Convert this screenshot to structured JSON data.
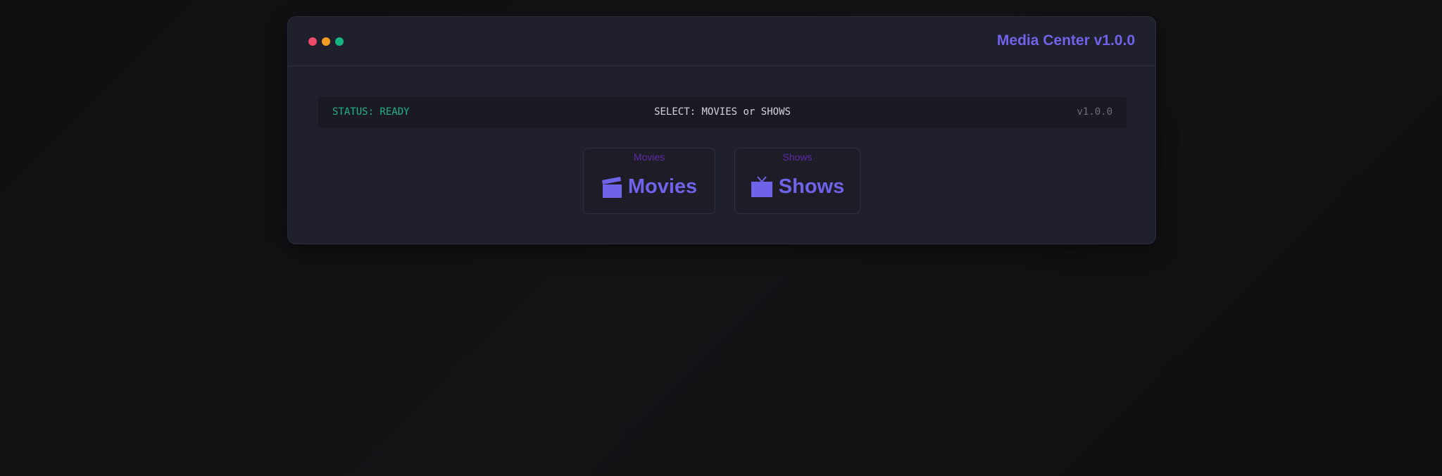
{
  "window": {
    "title": "Media Center v1.0.0",
    "controls": [
      {
        "name": "close",
        "color": "#ec4a6a"
      },
      {
        "name": "minimize",
        "color": "#f29a22"
      },
      {
        "name": "maximize",
        "color": "#17b583"
      }
    ]
  },
  "statusbar": {
    "status": "STATUS: READY",
    "prompt": "SELECT: MOVIES or SHOWS",
    "version": "v1.0.0"
  },
  "choices": [
    {
      "caption": "Movies",
      "label": "Movies",
      "icon": "clapperboard-icon"
    },
    {
      "caption": "Shows",
      "label": "Shows",
      "icon": "tv-icon"
    }
  ],
  "colors": {
    "accent": "#6f63ea",
    "caption": "#5c2ca8",
    "status_ok": "#1fb386",
    "background": "#111113",
    "panel": "#201f2c"
  }
}
